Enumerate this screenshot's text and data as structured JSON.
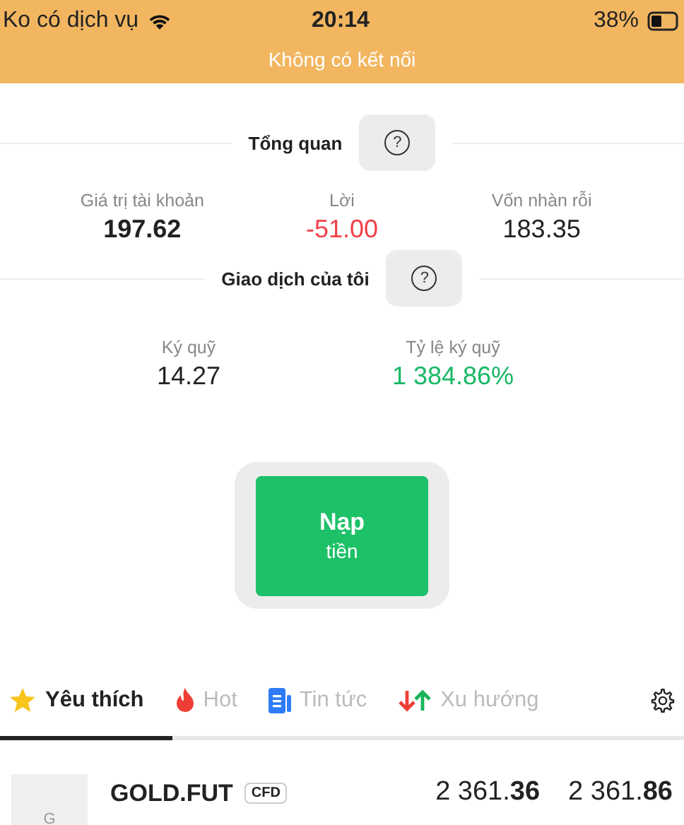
{
  "status_bar": {
    "carrier": "Ko có dịch vụ",
    "time": "20:14",
    "battery": "38%"
  },
  "banner": "Không có kết nối",
  "overview": {
    "title": "Tổng quan",
    "help": "?",
    "stats": [
      {
        "label": "Giá trị tài khoản",
        "value": "197.62",
        "kind": "strong"
      },
      {
        "label": "Lời",
        "value": "-51.00",
        "kind": "loss"
      },
      {
        "label": "Vốn nhàn rỗi",
        "value": "183.35",
        "kind": "normal"
      }
    ]
  },
  "trades": {
    "title": "Giao dịch của tôi",
    "help": "?",
    "stats": [
      {
        "label": "Ký quỹ",
        "value": "14.27",
        "kind": "normal"
      },
      {
        "label": "Tỷ lệ ký quỹ",
        "value": "1 384.86%",
        "kind": "gain"
      }
    ]
  },
  "deposit_button": {
    "title": "Nạp",
    "subtitle": "tiền"
  },
  "tabs": [
    {
      "label": "Yêu thích",
      "kind": "star",
      "selected": true
    },
    {
      "label": "Hot",
      "kind": "flame",
      "selected": false
    },
    {
      "label": "Tin tức",
      "kind": "news",
      "selected": false
    },
    {
      "label": "Xu hướng",
      "kind": "trend",
      "selected": false
    }
  ],
  "instruments": [
    {
      "avatar": "G",
      "name": "GOLD.FUT",
      "tag": "CFD",
      "sell": "2 361.**36**",
      "buy": "2 361.**86**"
    }
  ]
}
